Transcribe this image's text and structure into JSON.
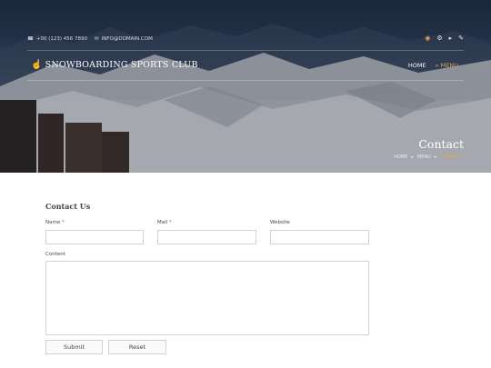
{
  "topbar": {
    "phone": "+00 (123) 456 7890",
    "email": "INFO@DOMAIN.COM",
    "social_icons": [
      "rss-icon",
      "gear-icon",
      "volume-icon",
      "edit-icon"
    ]
  },
  "brand": {
    "name": "SNOWBOARDING SPORTS CLUB",
    "icon": "hand-pointer-icon"
  },
  "nav": {
    "items": [
      {
        "label": "HOME"
      },
      {
        "label": "» MENU"
      }
    ]
  },
  "page": {
    "title": "Contact"
  },
  "breadcrumb": {
    "items": [
      "HOME",
      "MENU",
      "CONTACT"
    ],
    "separator": "▸"
  },
  "form": {
    "title": "Contact Us",
    "name_label": "Name",
    "mail_label": "Mail",
    "website_label": "Website",
    "content_label": "Content",
    "required_mark": "*",
    "submit_label": "Submit",
    "reset_label": "Reset"
  },
  "colors": {
    "accent": "#e0a35a",
    "required": "#d04a3a"
  }
}
